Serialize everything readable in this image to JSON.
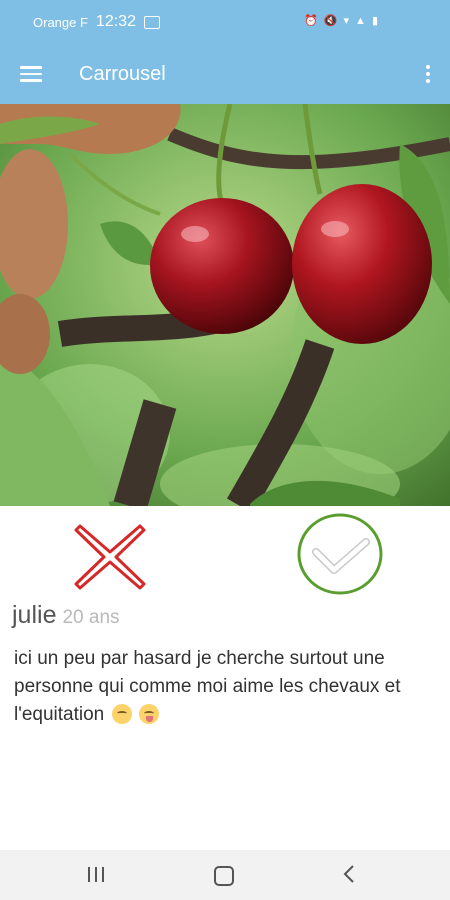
{
  "status_bar": {
    "carrier": "Orange F",
    "time": "12:32",
    "icons": [
      "image-icon",
      "alarm-icon",
      "mute-icon",
      "wifi-icon",
      "signal-icon",
      "battery-icon"
    ]
  },
  "app_bar": {
    "title": "Carrousel",
    "menu_icon": "hamburger-icon",
    "overflow_icon": "more-vert-icon"
  },
  "profile": {
    "photo_description": "",
    "name": "julie",
    "age": "20 ans",
    "bio": "ici un peu par hasard je cherche surtout une personne qui comme moi aime les chevaux et l'equitation",
    "bio_emojis": [
      "face-emoji",
      "face-with-tongue-emoji"
    ]
  },
  "actions": {
    "reject_icon": "cross-icon",
    "accept_icon": "check-icon",
    "reject_color": "#d62828",
    "accept_color": "#5a9e2f"
  },
  "nav_bar": {
    "buttons": [
      "recents-icon",
      "home-icon",
      "back-icon"
    ]
  },
  "colors": {
    "app_bar": "#7fbfe6",
    "name_text": "#555555",
    "age_text": "#b9b9b9"
  }
}
